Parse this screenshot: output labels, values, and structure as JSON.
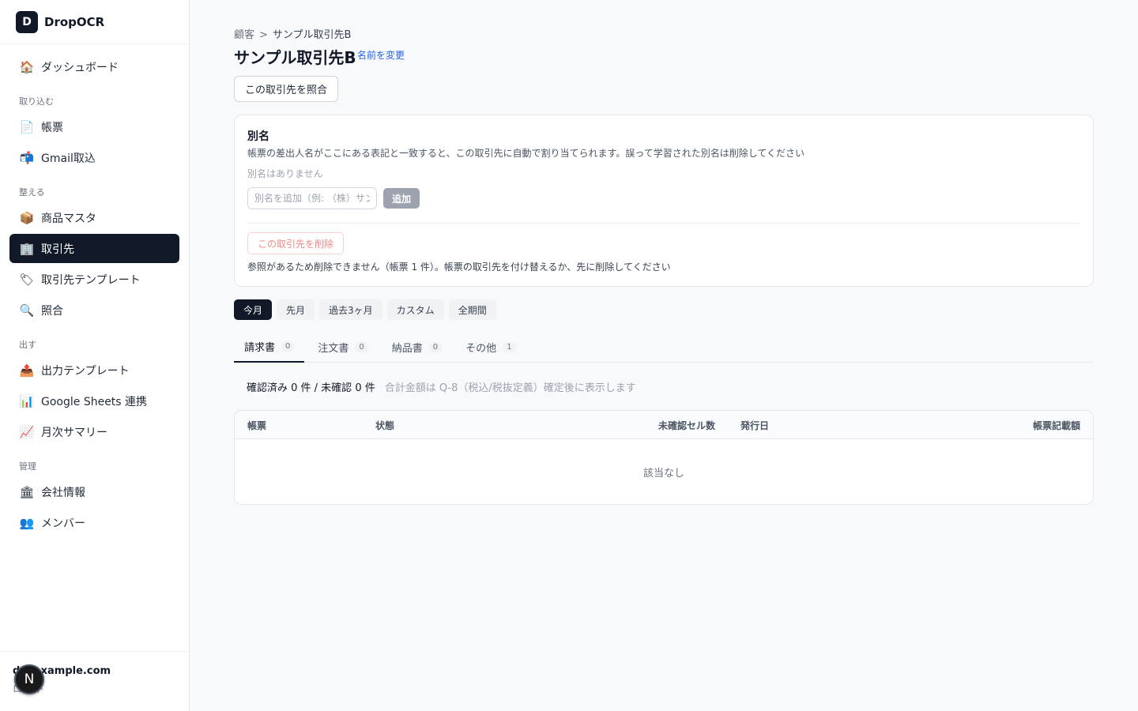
{
  "brand": {
    "logo_letter": "D",
    "name": "DropOCR"
  },
  "sidebar": {
    "top_items": [
      {
        "label": "ダッシュボード",
        "icon": "house-icon",
        "glyph": "🏠"
      }
    ],
    "sections": [
      {
        "title": "取り込む",
        "items": [
          {
            "label": "帳票",
            "icon": "document-icon",
            "glyph": "📄"
          },
          {
            "label": "Gmail取込",
            "icon": "mailbox-icon",
            "glyph": "📬"
          }
        ]
      },
      {
        "title": "整える",
        "items": [
          {
            "label": "商品マスタ",
            "icon": "package-icon",
            "glyph": "📦"
          },
          {
            "label": "取引先",
            "icon": "office-building-icon",
            "glyph": "🏢",
            "active": true
          },
          {
            "label": "取引先テンプレート",
            "icon": "label-tag-icon",
            "glyph": "🏷"
          },
          {
            "label": "照合",
            "icon": "magnifier-icon",
            "glyph": "🔍"
          }
        ]
      },
      {
        "title": "出す",
        "items": [
          {
            "label": "出力テンプレート",
            "icon": "outbox-tray-icon",
            "glyph": "📤"
          },
          {
            "label": "Google Sheets 連携",
            "icon": "bar-chart-icon",
            "glyph": "📊"
          },
          {
            "label": "月次サマリー",
            "icon": "trend-chart-icon",
            "glyph": "📈"
          }
        ]
      },
      {
        "title": "管理",
        "items": [
          {
            "label": "会社情報",
            "icon": "classical-building-icon",
            "glyph": "🏛"
          },
          {
            "label": "メンバー",
            "icon": "people-icon",
            "glyph": "👥"
          }
        ]
      }
    ]
  },
  "user": {
    "email": "d   @example.com",
    "logout": "ロ ウト",
    "avatar_letter": "N"
  },
  "breadcrumb": {
    "parent": "顧客",
    "separator": ">",
    "current": "サンプル取引先B"
  },
  "page": {
    "title": "サンプル取引先B",
    "rename": "名前を変更",
    "match_button": "この取引先を照合"
  },
  "alias_card": {
    "title": "別名",
    "description": "帳票の差出人名がここにある表記と一致すると、この取引先に自動で割り当てられます。誤って学習された別名は削除してください",
    "empty": "別名はありません",
    "input_placeholder": "別名を追加（例: （株）サンプル）",
    "add_button": "追加",
    "delete_button": "この取引先を削除",
    "delete_note": "参照があるため削除できません（帳票 1 件）。帳票の取引先を付け替えるか、先に削除してください"
  },
  "periods": [
    {
      "label": "今月",
      "active": true
    },
    {
      "label": "先月"
    },
    {
      "label": "過去3ヶ月"
    },
    {
      "label": "カスタム"
    },
    {
      "label": "全期間"
    }
  ],
  "tabs": [
    {
      "label": "請求書",
      "count": "0",
      "active": true
    },
    {
      "label": "注文書",
      "count": "0"
    },
    {
      "label": "納品書",
      "count": "0"
    },
    {
      "label": "その他",
      "count": "1"
    }
  ],
  "summary": {
    "counts": "確認済み 0 件 / 未確認 0 件",
    "note": "合計金額は Q-8（税込/税抜定義）確定後に表示します"
  },
  "table": {
    "columns": [
      "帳票",
      "状態",
      "未確認セル数",
      "発行日",
      "帳票記載額"
    ],
    "empty": "該当なし"
  },
  "colors": {
    "accent": "#111827",
    "link": "#2563eb",
    "danger": "#f08a8a"
  }
}
